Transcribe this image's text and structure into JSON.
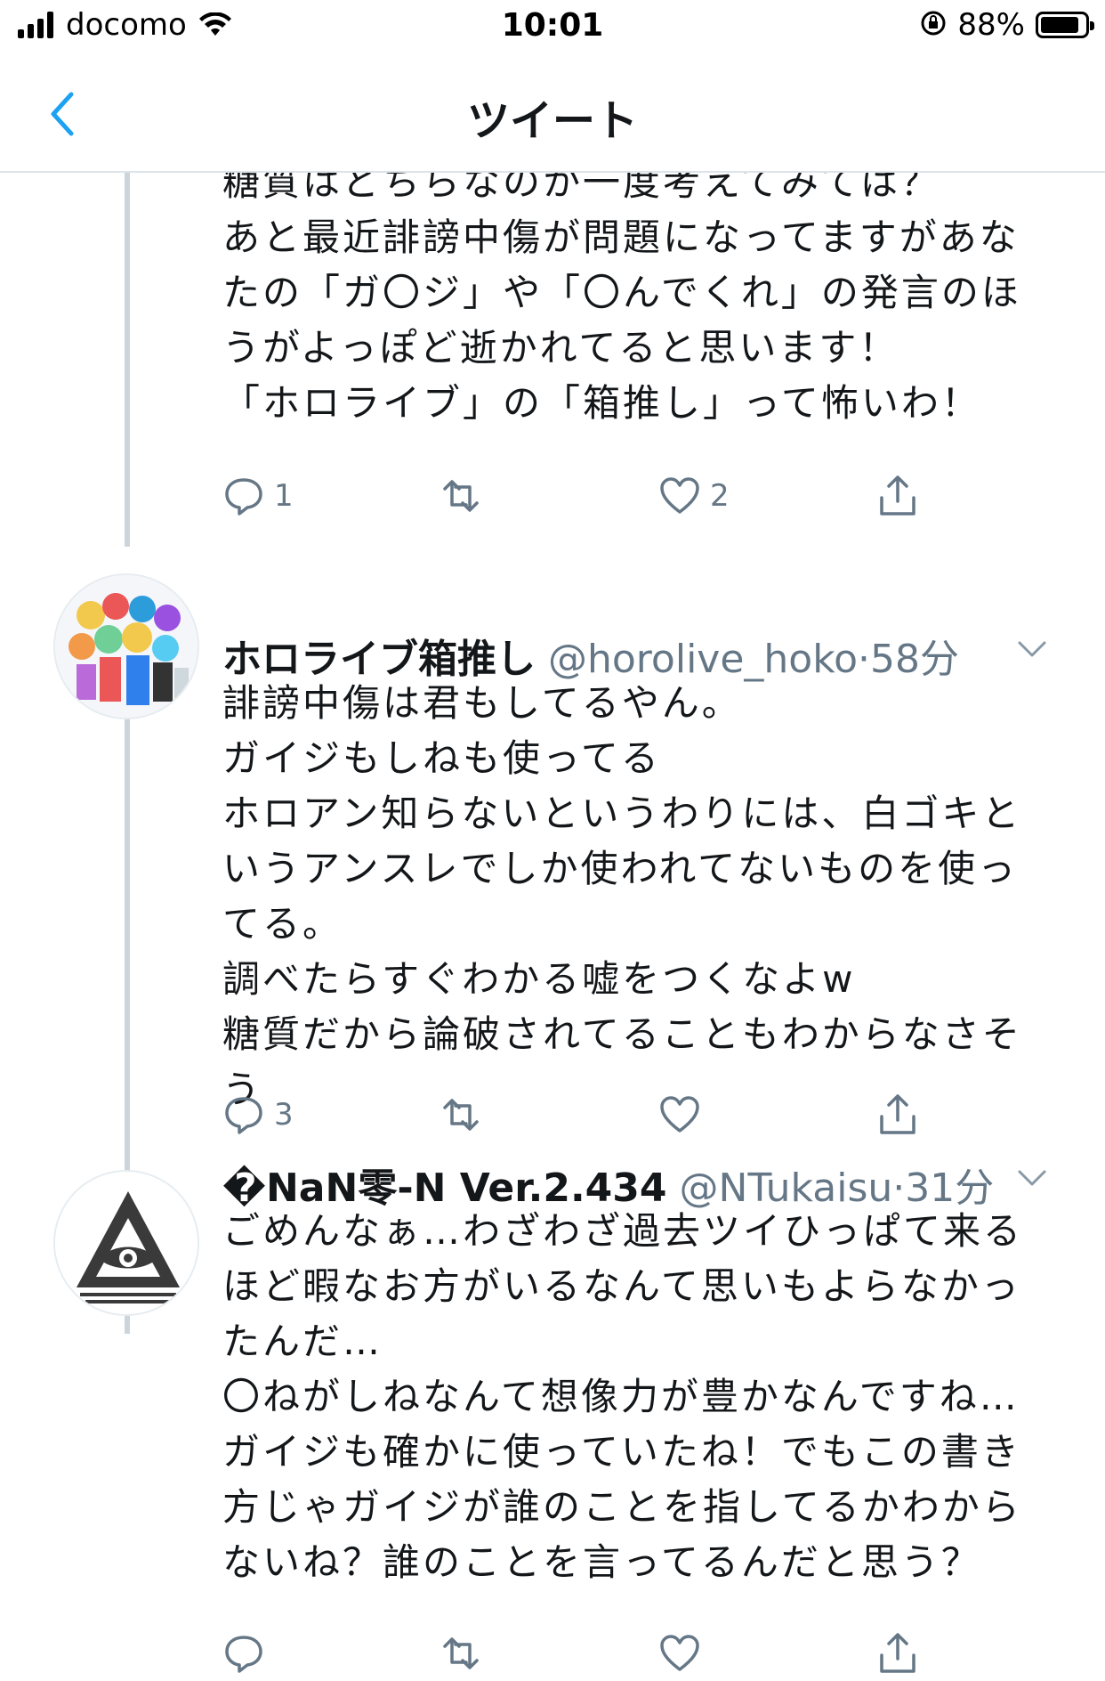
{
  "status_bar": {
    "carrier": "docomo",
    "time": "10:01",
    "battery_percent": "88%",
    "battery_level": 0.88
  },
  "nav": {
    "title": "ツイート"
  },
  "tweets": [
    {
      "body": [
        "糖質はどちらなのか一度考えてみては？",
        "あと最近誹謗中傷が問題になってますがあな",
        "たの「ガ〇ジ」や「〇んでくれ」の発言のほ",
        "うがよっぽど逝かれてると思います！",
        "「ホロライブ」の「箱推し」って怖いわ！"
      ],
      "reply_count": "1",
      "like_count": "2"
    },
    {
      "name": "ホロライブ箱推し",
      "handle": "@horolive_hoko",
      "separator": "·",
      "time": "58分",
      "body": [
        "誹謗中傷は君もしてるやん。",
        "ガイジもしねも使ってる",
        "ホロアン知らないというわりには、白ゴキと",
        "いうアンスレでしか使われてないものを使っ",
        "てる。",
        "調べたらすぐわかる嘘をつくなよw",
        "糖質だから論破されてることもわからなさそ",
        "う"
      ],
      "reply_count": "3",
      "like_count": ""
    },
    {
      "name": "�NaN零-N Ver.2.434",
      "handle": "@NTukaisu",
      "separator": "·",
      "time": "31分",
      "body": [
        "ごめんなぁ…わざわざ過去ツイひっぱて来る",
        "ほど暇なお方がいるなんて思いもよらなかっ",
        "たんだ…",
        "〇ねがしねなんて想像力が豊かなんですね…",
        "ガイジも確かに使っていたね！でもこの書き",
        "方じゃガイジが誰のことを指してるかわから",
        "ないね？誰のことを言ってるんだと思う？"
      ],
      "reply_count": "",
      "like_count": ""
    }
  ]
}
